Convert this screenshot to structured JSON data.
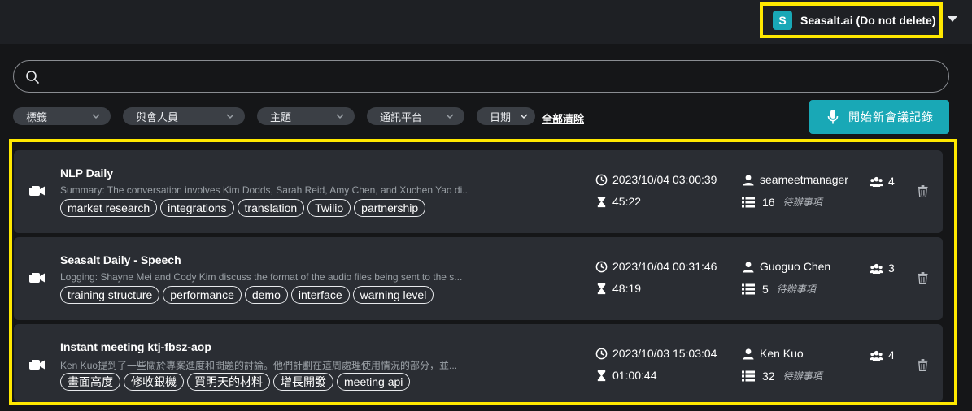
{
  "account": {
    "badge": "S",
    "name": "Seasalt.ai (Do not delete)"
  },
  "search": {
    "placeholder": "",
    "value": ""
  },
  "filters": [
    {
      "label": "標籤"
    },
    {
      "label": "與會人員"
    },
    {
      "label": "主題"
    },
    {
      "label": "通訊平台"
    },
    {
      "label": "日期"
    }
  ],
  "clear_all": "全部清除",
  "new_button": "開始新會議記錄",
  "todo_label": "待辦事項",
  "meetings": [
    {
      "title": "NLP Daily",
      "summary": "Summary: The conversation involves Kim Dodds, Sarah Reid, Amy Chen, and Xuchen Yao di...",
      "tags": [
        "market research",
        "integrations",
        "translation",
        "Twilio",
        "partnership"
      ],
      "datetime": "2023/10/04 03:00:39",
      "duration": "45:22",
      "owner": "seameetmanager",
      "todo_count": "16",
      "participants": "4"
    },
    {
      "title": "Seasalt Daily - Speech",
      "summary": "Logging: Shayne Mei and Cody Kim discuss the format of the audio files being sent to the s...",
      "tags": [
        "training structure",
        "performance",
        "demo",
        "interface",
        "warning level"
      ],
      "datetime": "2023/10/04 00:31:46",
      "duration": "48:19",
      "owner": "Guoguo Chen",
      "todo_count": "5",
      "participants": "3"
    },
    {
      "title": "Instant meeting ktj-fbsz-aop",
      "summary": "Ken Kuo提到了一些關於專案進度和問題的討論。他們計劃在這周處理使用情況的部分，並...",
      "tags": [
        "畫面高度",
        "修收銀機",
        "買明天的材料",
        "增長開發",
        "meeting api"
      ],
      "datetime": "2023/10/03 15:03:04",
      "duration": "01:00:44",
      "owner": "Ken Kuo",
      "todo_count": "32",
      "participants": "4"
    }
  ]
}
